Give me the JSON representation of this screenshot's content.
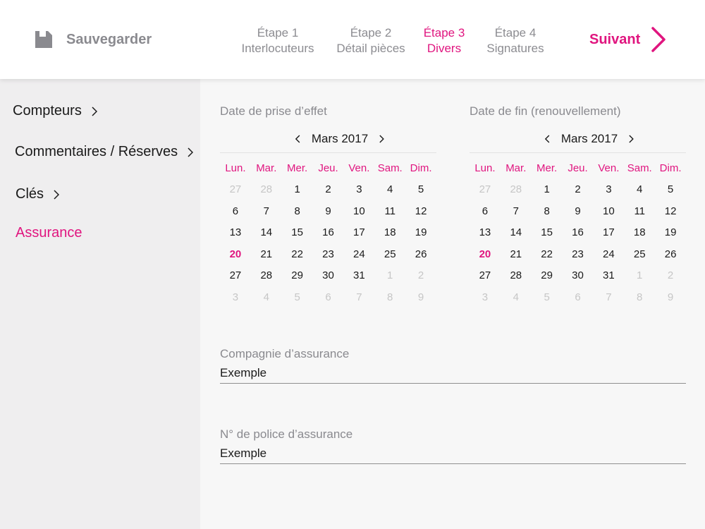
{
  "header": {
    "save_label": "Sauvegarder",
    "steps": [
      {
        "line1": "Étape 1",
        "line2": "Interlocuteurs",
        "active": false
      },
      {
        "line1": "Étape 2",
        "line2": "Détail pièces",
        "active": false
      },
      {
        "line1": "Étape 3",
        "line2": "Divers",
        "active": true
      },
      {
        "line1": "Étape 4",
        "line2": "Signatures",
        "active": false
      }
    ],
    "next_label": "Suivant"
  },
  "colors": {
    "accent": "#e0157f",
    "muted_text": "#8a8a8f",
    "sidebar_bg": "#efeeef",
    "main_bg": "#f7f7f7"
  },
  "icons": {
    "save": "floppy-disk-icon",
    "next": "chevron-right-icon",
    "prev_month": "chevron-left-icon",
    "next_month": "chevron-right-icon"
  },
  "sidebar": {
    "items": [
      {
        "label": "Compteurs",
        "has_chevron": true,
        "active": false
      },
      {
        "label": "Commentaires / Réserves",
        "has_chevron": true,
        "active": false
      },
      {
        "label": "Clés",
        "has_chevron": true,
        "active": false
      },
      {
        "label": "Assurance",
        "has_chevron": false,
        "active": true
      }
    ]
  },
  "calendars": [
    {
      "title": "Date de prise d’effet",
      "month": "Mars 2017",
      "weekdays": [
        "Lun.",
        "Mar.",
        "Mer.",
        "Jeu.",
        "Ven.",
        "Sam.",
        "Dim."
      ],
      "weeks": [
        [
          "27",
          "28",
          "1",
          "2",
          "3",
          "4",
          "5"
        ],
        [
          "6",
          "7",
          "8",
          "9",
          "10",
          "11",
          "12"
        ],
        [
          "13",
          "14",
          "15",
          "16",
          "17",
          "18",
          "19"
        ],
        [
          "20",
          "21",
          "22",
          "23",
          "24",
          "25",
          "26"
        ],
        [
          "27",
          "28",
          "29",
          "30",
          "31",
          "1",
          "2"
        ],
        [
          "3",
          "4",
          "5",
          "6",
          "7",
          "8",
          "9"
        ]
      ],
      "highlighted_day": "20"
    },
    {
      "title": "Date de fin (renouvellement)",
      "month": "Mars 2017",
      "weekdays": [
        "Lun.",
        "Mar.",
        "Mer.",
        "Jeu.",
        "Ven.",
        "Sam.",
        "Dim."
      ],
      "weeks": [
        [
          "27",
          "28",
          "1",
          "2",
          "3",
          "4",
          "5"
        ],
        [
          "6",
          "7",
          "8",
          "9",
          "10",
          "11",
          "12"
        ],
        [
          "13",
          "14",
          "15",
          "16",
          "17",
          "18",
          "19"
        ],
        [
          "20",
          "21",
          "22",
          "23",
          "24",
          "25",
          "26"
        ],
        [
          "27",
          "28",
          "29",
          "30",
          "31",
          "1",
          "2"
        ],
        [
          "3",
          "4",
          "5",
          "6",
          "7",
          "8",
          "9"
        ]
      ],
      "highlighted_day": "20"
    }
  ],
  "fields": [
    {
      "label": "Compagnie d’assurance",
      "value": "Exemple"
    },
    {
      "label": "N° de police d’assurance",
      "value": "Exemple"
    }
  ]
}
